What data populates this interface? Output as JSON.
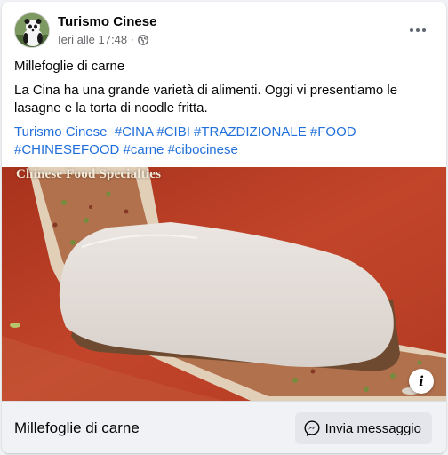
{
  "post": {
    "page_name": "Turismo Cinese",
    "timestamp": "Ieri alle 17:48",
    "separator": "·",
    "audience_icon": "globe-icon",
    "title": "Millefoglie di carne",
    "body": "La Cina ha una grande varietà di alimenti. Oggi vi presentiamo le lasagne e la torta di noodle fritta.",
    "tags_line1": [
      "Turismo Cinese",
      "#CINA",
      "#CIBI",
      "#TRAZDIZIONALE",
      "#FOOD"
    ],
    "tags_line2": [
      "#CHINESEFOOD",
      "#carne",
      "#cibocinese"
    ]
  },
  "media": {
    "caption": "Chinese Food Specialties",
    "info_label": "i"
  },
  "footer": {
    "title": "Millefoglie di carne",
    "message_button": "Invia messaggio"
  }
}
